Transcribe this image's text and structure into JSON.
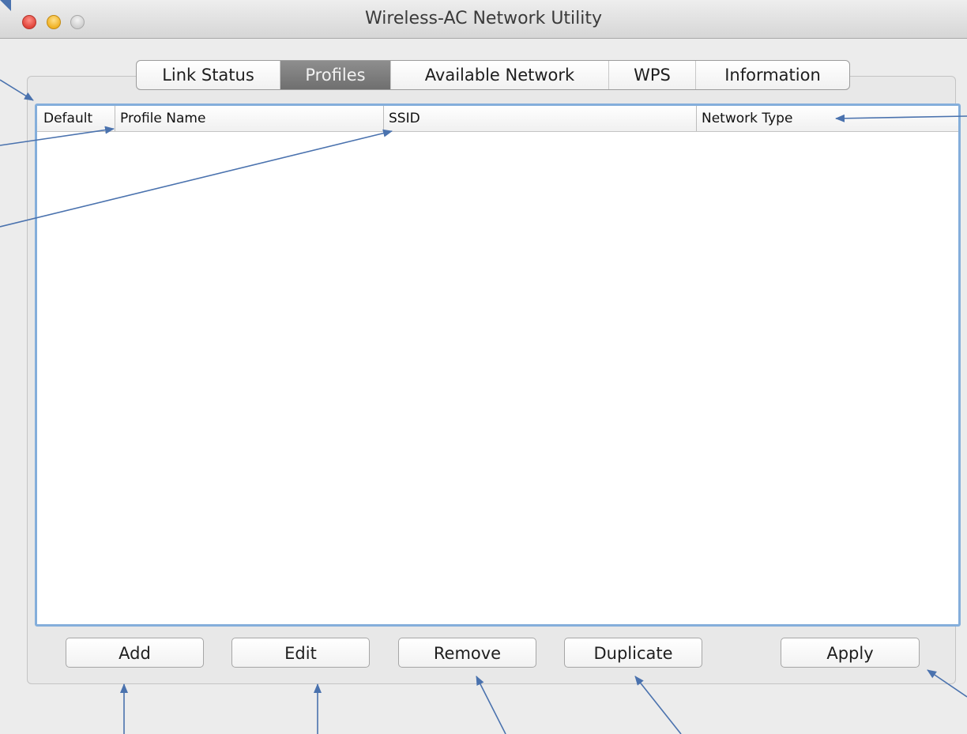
{
  "window": {
    "title": "Wireless-AC Network Utility"
  },
  "tabs": [
    {
      "label": "Link Status",
      "active": false
    },
    {
      "label": "Profiles",
      "active": true
    },
    {
      "label": "Available Network",
      "active": false
    },
    {
      "label": "WPS",
      "active": false
    },
    {
      "label": "Information",
      "active": false
    }
  ],
  "table": {
    "columns": [
      "Default",
      "Profile Name",
      "SSID",
      "Network Type"
    ],
    "rows": []
  },
  "buttons": {
    "add": "Add",
    "edit": "Edit",
    "remove": "Remove",
    "duplicate": "Duplicate",
    "apply": "Apply"
  },
  "colors": {
    "selection_focus_ring": "#84aedb",
    "annotation_arrow": "#4a72ae",
    "active_tab": "#7a7a7a"
  }
}
